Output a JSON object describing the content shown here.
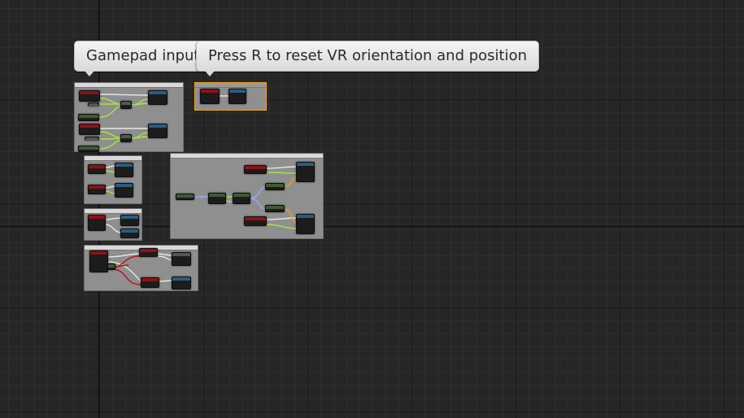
{
  "bubbles": {
    "gamepad": "Gamepad input",
    "reset_vr": "Press R to reset VR orientation and position"
  },
  "colors": {
    "exec_wire": "#e8e8e8",
    "float_wire": "#a6e34a",
    "vector_wire": "#9aa8ff",
    "bool_wire": "#b5121b",
    "struct_wire": "#f0a020",
    "selection": "#f0a020"
  }
}
